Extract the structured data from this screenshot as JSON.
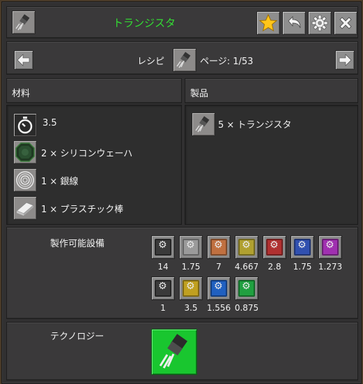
{
  "header": {
    "title": "トランジスタ",
    "title_color": "#33dd33",
    "icon": "transistor-icon",
    "buttons": [
      "favorite-star-icon",
      "back-arrow-icon",
      "settings-gear-icon",
      "close-x-icon"
    ]
  },
  "navigation": {
    "recipe_label": "レシピ",
    "page_label": "ページ: 1/53",
    "prev_icon": "arrow-left-icon",
    "next_icon": "arrow-right-icon"
  },
  "ingredients": {
    "heading": "材料",
    "time": "3.5",
    "items": [
      {
        "text": "2 × シリコンウェーハ",
        "icon": "silicon-wafer-icon"
      },
      {
        "text": "1 × 銀線",
        "icon": "silver-wire-icon"
      },
      {
        "text": "1 × プラスチック棒",
        "icon": "plastic-bar-icon"
      }
    ]
  },
  "products": {
    "heading": "製品",
    "items": [
      {
        "text": "5 × トランジスタ",
        "icon": "transistor-icon"
      }
    ]
  },
  "machines": {
    "heading": "製作可能設備",
    "row1": [
      {
        "value": "14",
        "color": "#3a3a3a"
      },
      {
        "value": "1.75",
        "color": "#9a9a9a"
      },
      {
        "value": "7",
        "color": "#c07040"
      },
      {
        "value": "4.667",
        "color": "#b0a030"
      },
      {
        "value": "2.8",
        "color": "#b03030"
      },
      {
        "value": "1.75",
        "color": "#3050b0"
      },
      {
        "value": "1.273",
        "color": "#a030b0"
      }
    ],
    "row2": [
      {
        "value": "1",
        "color": "#3a3a3a"
      },
      {
        "value": "3.5",
        "color": "#c0a020"
      },
      {
        "value": "1.556",
        "color": "#2060c0"
      },
      {
        "value": "0.875",
        "color": "#20a040"
      }
    ]
  },
  "technology": {
    "heading": "テクノロジー",
    "icon": "transistor-technology-icon",
    "color": "#19c62f"
  }
}
